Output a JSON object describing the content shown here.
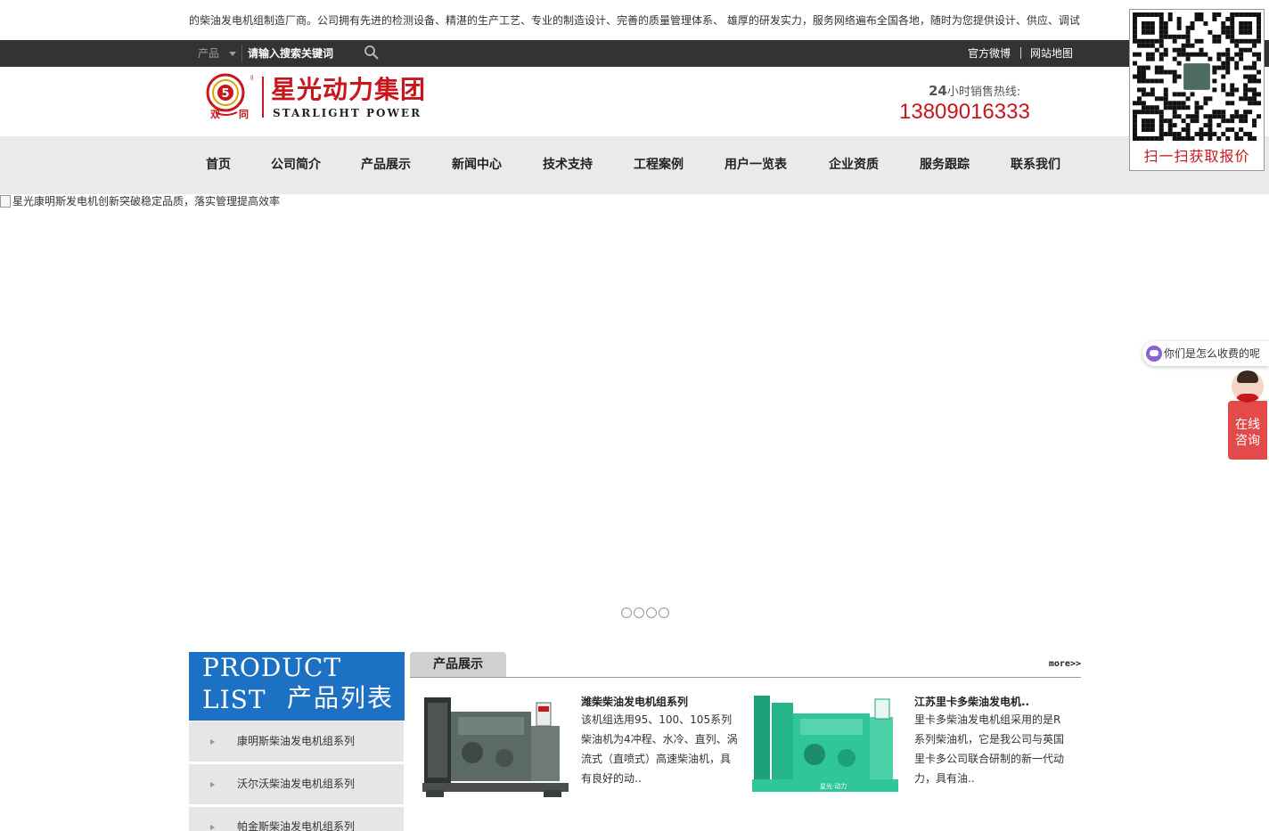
{
  "marquee": {
    "text": "的柴油发电机组制造厂商。公司拥有先进的检测设备、精湛的生产工艺、专业的制造设计、完善的质量管理体系、 雄厚的研发实力，服务网络遍布全国各地，随时为您提供设计、供应、调试"
  },
  "topbar": {
    "search_category": "产品",
    "search_placeholder": "请输入搜索关键词",
    "links": [
      "官方微博",
      "网站地图"
    ]
  },
  "header": {
    "logo_cn": "星光动力集团",
    "logo_en": "STARLIGHT POWER",
    "hotline_prefix": "24",
    "hotline_label": "小时销售热线:",
    "hotline_number": "13809016333"
  },
  "nav": {
    "items": [
      "首页",
      "公司简介",
      "产品展示",
      "新闻中心",
      "技术支持",
      "工程案例",
      "用户一览表",
      "企业资质",
      "服务跟踪",
      "联系我们"
    ]
  },
  "qr": {
    "caption": "扫一扫获取报价"
  },
  "banner": {
    "alt_text": "星光康明斯发电机创新突破稳定品质，落实管理提高效率",
    "slide_count": 4
  },
  "chat": {
    "bubble_text": "你们是怎么收费的呢",
    "consult_label_1": "在线",
    "consult_label_2": "咨询"
  },
  "product_list": {
    "title_en": "PRODUCT LIST",
    "title_cn": "产品列表",
    "items": [
      "康明斯柴油发电机组系列",
      "沃尔沃柴油发电机组系列",
      "帕金斯柴油发电机组系列"
    ]
  },
  "products": {
    "tab_label": "产品展示",
    "more_label": "more>>",
    "items": [
      {
        "title": "潍柴柴油发电机组系列",
        "desc": "该机组选用95、100、105系列柴油机为4冲程、水冷、直列、涡流式（直喷式）高速柴油机，具有良好的动.."
      },
      {
        "title": "江苏里卡多柴油发电机..",
        "desc": "里卡多柴油发电机组采用的是R系列柴油机，它是我公司与英国里卡多公司联合研制的新一代动力，具有油.."
      }
    ]
  },
  "colors": {
    "brand_red": "#c8161d",
    "topbar": "#333333",
    "nav_bg": "#eaeaea",
    "list_blue": "#1d71c5",
    "genset_green": "#2fc79a",
    "genset_gray": "#5c6a64"
  }
}
